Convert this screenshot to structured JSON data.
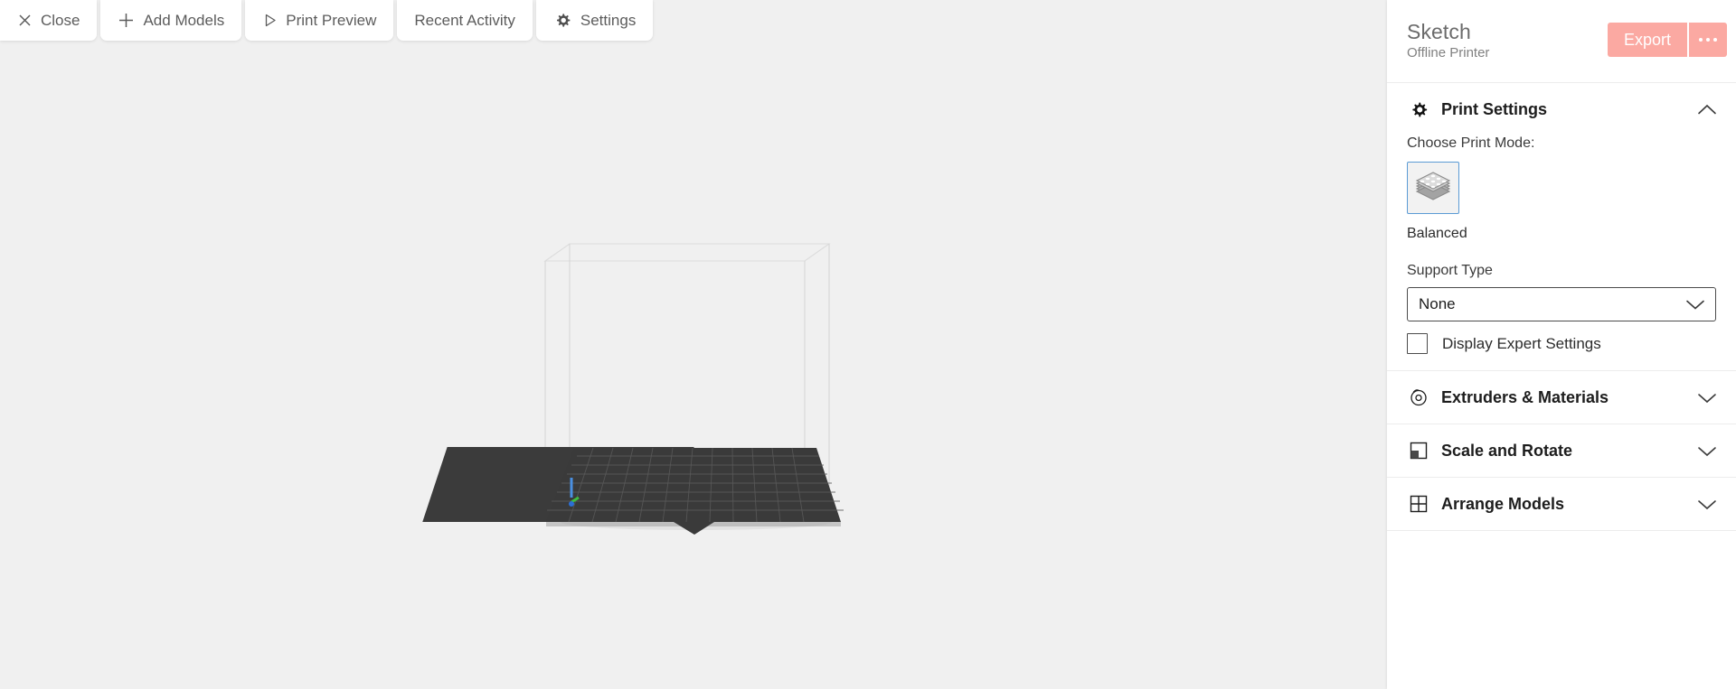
{
  "toolbar": {
    "buttons": [
      {
        "label": "Close",
        "icon": "close-icon"
      },
      {
        "label": "Add Models",
        "icon": "plus-icon"
      },
      {
        "label": "Print Preview",
        "icon": "play-triangle-icon"
      },
      {
        "label": "Recent Activity",
        "icon": "none"
      },
      {
        "label": "Settings",
        "icon": "gear-icon"
      }
    ]
  },
  "printer": {
    "name": "Sketch",
    "status": "Offline Printer",
    "chevron_icon": "chevron-down-icon",
    "export_label": "Export",
    "more_icon": "ellipsis-icon"
  },
  "sections": {
    "print_settings": {
      "title": "Print Settings",
      "icon": "gear-icon",
      "chevron_icon": "chevron-up-icon",
      "expanded": true,
      "print_mode_label": "Choose Print Mode:",
      "print_mode_icon": "layered-cube-icon",
      "print_mode_value": "Balanced",
      "support_type_label": "Support Type",
      "support_type_value": "None",
      "support_type_chevron": "chevron-down-icon",
      "expert_settings_label": "Display Expert Settings",
      "expert_settings_checked": false
    },
    "extruders": {
      "title": "Extruders & Materials",
      "icon": "spool-icon",
      "chevron_icon": "chevron-down-icon"
    },
    "scale_rotate": {
      "title": "Scale and Rotate",
      "icon": "scale-square-icon",
      "chevron_icon": "chevron-down-icon"
    },
    "arrange": {
      "title": "Arrange Models",
      "icon": "grid-icon",
      "chevron_icon": "chevron-down-icon"
    }
  },
  "viewport": {
    "build_volume_name": "build-volume-wireframe",
    "build_plate_name": "build-plate-grid"
  },
  "colors": {
    "accent": "#fba9a2",
    "selected_border": "#5b9bd5",
    "viewport_bg": "#f0f0f0",
    "panel_bg": "#ffffff",
    "build_plate": "#3a3a3a"
  }
}
